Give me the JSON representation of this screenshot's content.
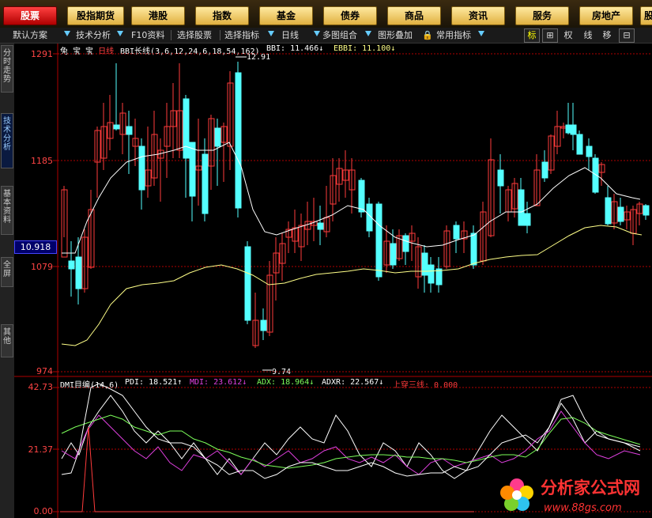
{
  "top_tabs": [
    "股票",
    "股指期货",
    "港股",
    "指数",
    "基金",
    "债券",
    "商品",
    "资讯",
    "服务",
    "房地产",
    "股"
  ],
  "toolbar": {
    "items": [
      "默认方案",
      "技术分析",
      "F10资料",
      "选择股票",
      "选择指标",
      "日线",
      "多图组合",
      "图形叠加",
      "常用指标"
    ],
    "right_buttons": [
      "标",
      "⊞",
      "权",
      "线",
      "移",
      "⊟"
    ]
  },
  "sidebar_tabs": [
    "分时走势",
    "技术分析",
    "基本资料",
    "全屏",
    "其他"
  ],
  "price_chart": {
    "stock_name": "兔 宝 宝",
    "period": "日线",
    "indicator_line": "BBI长线(3,6,12,24,6,18,54,162)",
    "bbi": "BBI: 11.466↓",
    "ebbi": "EBBI: 11.100↓",
    "high_label": "12.91",
    "low_label": "9.74",
    "y_labels": [
      "1291",
      "1185",
      "1079",
      "974"
    ],
    "current_price": "10.918"
  },
  "dmi_chart": {
    "title": "DMI目编(14,6)",
    "pdi": "PDI: 18.521↑",
    "mdi": "MDI: 23.612↓",
    "adx": "ADX: 18.964↓",
    "adxr": "ADXR: 22.567↓",
    "cross": "上穿三线: 0.000",
    "y_labels": [
      "42.73",
      "21.37",
      "0.00"
    ]
  },
  "watermark": {
    "name": "分析家公式网",
    "url": "www.88gs.com"
  },
  "colors": {
    "up": "#ff3b3b",
    "down": "#54ffff",
    "bbi": "#ffffff",
    "ebbi": "#ffff88",
    "pdi": "#ffffff",
    "mdi": "#e040e0",
    "adx": "#7cff5a",
    "adxr": "#ffffff",
    "grid": "#b00000"
  }
}
